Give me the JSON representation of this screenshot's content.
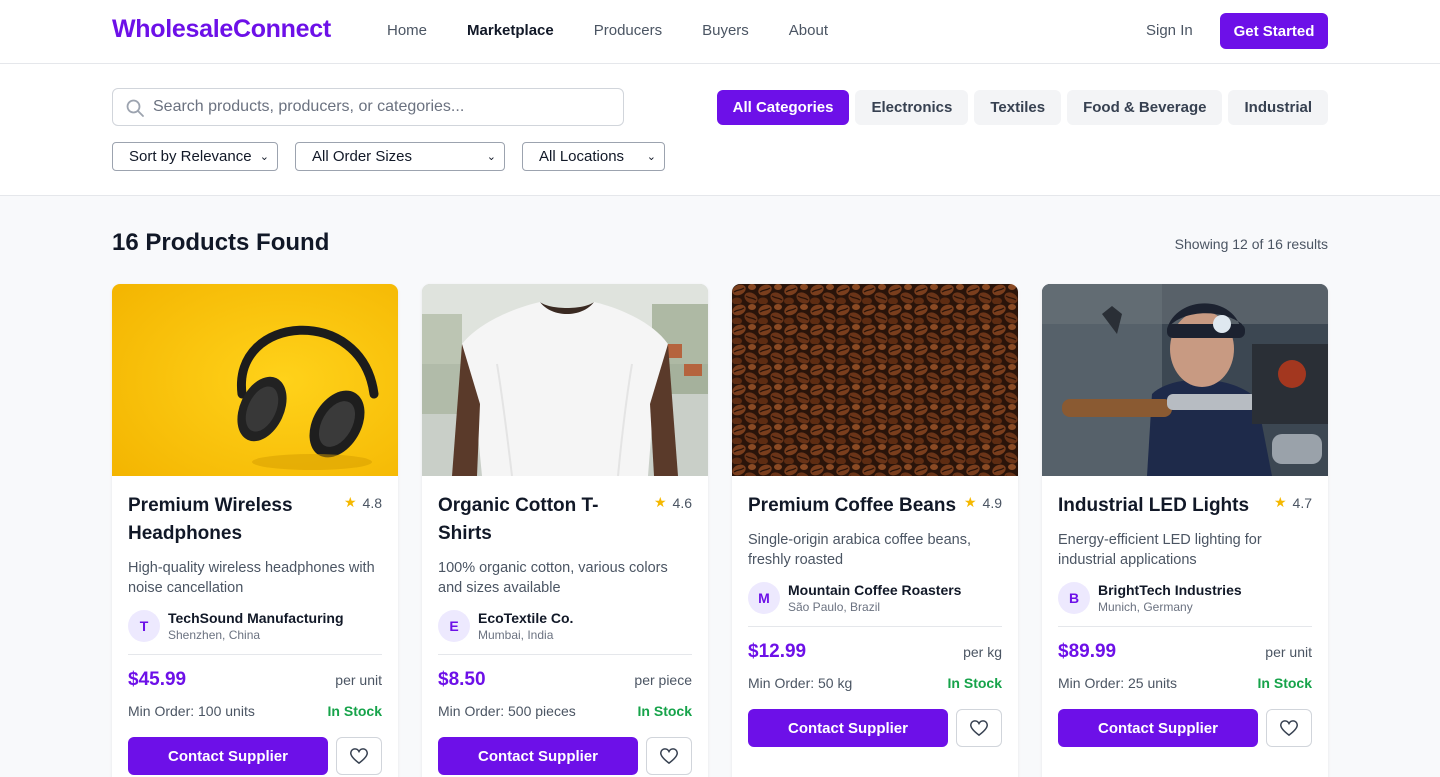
{
  "header": {
    "logo": "WholesaleConnect",
    "nav": [
      "Home",
      "Marketplace",
      "Producers",
      "Buyers",
      "About"
    ],
    "active_nav": "Marketplace",
    "sign_in": "Sign In",
    "get_started": "Get Started"
  },
  "filters": {
    "search_placeholder": "Search products, producers, or categories...",
    "categories": [
      "All Categories",
      "Electronics",
      "Textiles",
      "Food & Beverage",
      "Industrial"
    ],
    "active_category": "All Categories",
    "sort": "Sort by Relevance",
    "order_size": "All Order Sizes",
    "location": "All Locations"
  },
  "results": {
    "title": "16 Products Found",
    "count": "Showing 12 of 16 results"
  },
  "products": [
    {
      "title": "Premium Wireless Headphones",
      "rating": "4.8",
      "description": "High-quality wireless headphones with noise cancellation",
      "supplier_initial": "T",
      "supplier": "TechSound Manufacturing",
      "location": "Shenzhen, China",
      "price": "$45.99",
      "unit": "per unit",
      "min_order": "Min Order: 100 units",
      "stock": "In Stock",
      "contact": "Contact Supplier",
      "image": "headphones-photo"
    },
    {
      "title": "Organic Cotton T-Shirts",
      "rating": "4.6",
      "description": "100% organic cotton, various colors and sizes available",
      "supplier_initial": "E",
      "supplier": "EcoTextile Co.",
      "location": "Mumbai, India",
      "price": "$8.50",
      "unit": "per piece",
      "min_order": "Min Order: 500 pieces",
      "stock": "In Stock",
      "contact": "Contact Supplier",
      "image": "tshirt-photo"
    },
    {
      "title": "Premium Coffee Beans",
      "rating": "4.9",
      "description": "Single-origin arabica coffee beans, freshly roasted",
      "supplier_initial": "M",
      "supplier": "Mountain Coffee Roasters",
      "location": "São Paulo, Brazil",
      "price": "$12.99",
      "unit": "per kg",
      "min_order": "Min Order: 50 kg",
      "stock": "In Stock",
      "contact": "Contact Supplier",
      "image": "coffee-beans-photo"
    },
    {
      "title": "Industrial LED Lights",
      "rating": "4.7",
      "description": "Energy-efficient LED lighting for industrial applications",
      "supplier_initial": "B",
      "supplier": "BrightTech Industries",
      "location": "Munich, Germany",
      "price": "$89.99",
      "unit": "per unit",
      "min_order": "Min Order: 25 units",
      "stock": "In Stock",
      "contact": "Contact Supplier",
      "image": "industrial-worker-photo"
    }
  ],
  "colors": {
    "brand": "#6d10e8",
    "stock": "#16a34a",
    "star": "#f5b800"
  }
}
